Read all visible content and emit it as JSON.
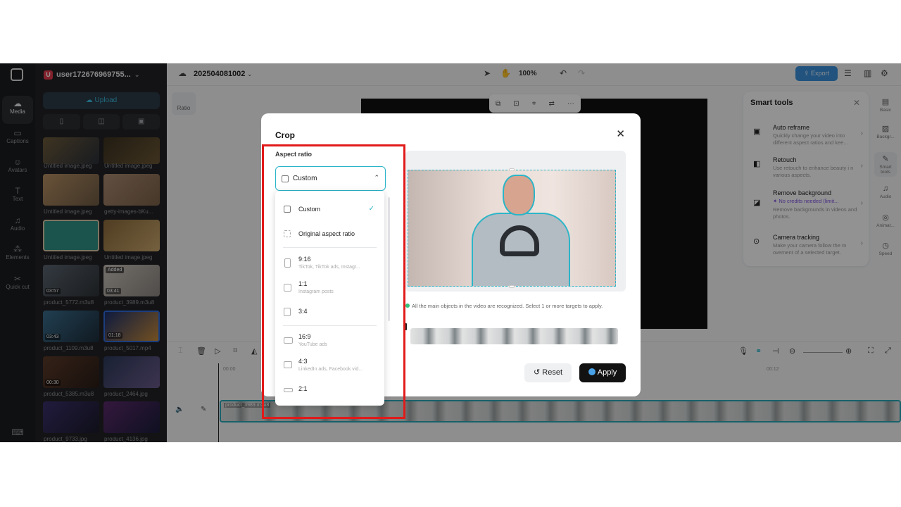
{
  "account": {
    "name": "user172676969755...",
    "badge": "U"
  },
  "media": {
    "upload_label": "Upload",
    "items": [
      {
        "name": "Untitled image.jpeg",
        "duration": ""
      },
      {
        "name": "Untitled image.jpeg",
        "duration": ""
      },
      {
        "name": "Untitled image.jpeg",
        "duration": ""
      },
      {
        "name": "getty-images-bKu...",
        "duration": ""
      },
      {
        "name": "Untitled image.jpeg",
        "duration": ""
      },
      {
        "name": "Untitled image.jpeg",
        "duration": ""
      },
      {
        "name": "product_5772.m3u8",
        "duration": "03:57"
      },
      {
        "name": "product_3989.m3u8",
        "duration": "03:41",
        "added": "Added"
      },
      {
        "name": "product_1109.m3u8",
        "duration": "03:43"
      },
      {
        "name": "product_5017.mp4",
        "duration": "01:18"
      },
      {
        "name": "product_5385.m3u8",
        "duration": "00:30"
      },
      {
        "name": "product_2464.jpg",
        "duration": ""
      },
      {
        "name": "product_9733.jpg",
        "duration": ""
      },
      {
        "name": "product_4136.jpg",
        "duration": ""
      }
    ]
  },
  "rail": {
    "items": [
      "Media",
      "Captions",
      "Avatars",
      "Text",
      "Audio",
      "Elements",
      "Quick cut"
    ]
  },
  "topbar": {
    "project": "202504081002",
    "zoom": "100%",
    "export_label": "Export"
  },
  "canvas": {
    "ratio_label": "Ratio"
  },
  "smart_tools": {
    "title": "Smart tools",
    "items": [
      {
        "title": "Auto reframe",
        "desc": "Quickly change your video into different aspect ratios and kee..."
      },
      {
        "title": "Retouch",
        "desc": "Use retouch to enhance beauty i n various aspects."
      },
      {
        "title": "Remove background",
        "credit": "✦ No credits needed (limit...",
        "desc": "Remove backgrounds in videos and photos."
      },
      {
        "title": "Camera tracking",
        "desc": "Make your camera follow the m ovement of a selected target."
      }
    ]
  },
  "right_side": {
    "items": [
      "Basic",
      "Backgr...",
      "Smart tools",
      "Audio",
      "Animat...",
      "Speed"
    ]
  },
  "timeline": {
    "track_name": "product_3989.m3u8",
    "time_start": "00:00",
    "time_end": "00:12"
  },
  "crop_dialog": {
    "title": "Crop",
    "aspect_ratio_label": "Aspect ratio",
    "selected": "Custom",
    "options": [
      {
        "label": "Custom",
        "desc": "",
        "checked": true
      },
      {
        "label": "Original aspect ratio",
        "desc": ""
      },
      {
        "label": "9:16",
        "desc": "TikTok, TikTok ads, Instagr..."
      },
      {
        "label": "1:1",
        "desc": "Instagram posts"
      },
      {
        "label": "3:4",
        "desc": ""
      },
      {
        "label": "16:9",
        "desc": "YouTube ads"
      },
      {
        "label": "4:3",
        "desc": "LinkedIn ads, Facebook vid..."
      },
      {
        "label": "2:1",
        "desc": ""
      }
    ],
    "recognized_text": "All the main objects in the video are recognized. Select 1 or more targets to apply.",
    "reset_label": "Reset",
    "apply_label": "Apply"
  }
}
